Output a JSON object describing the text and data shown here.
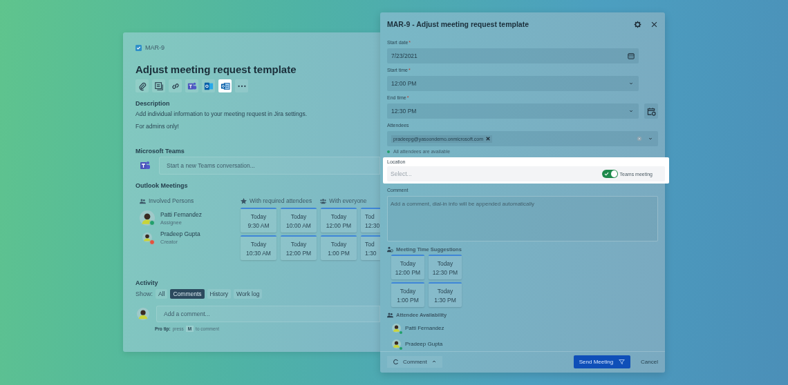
{
  "issue": {
    "key": "MAR-9",
    "title": "Adjust meeting request template",
    "toolbar": [
      {
        "kind": "attach",
        "selected": false
      },
      {
        "kind": "checklist",
        "selected": false
      },
      {
        "kind": "link",
        "selected": false
      },
      {
        "kind": "teams",
        "selected": false
      },
      {
        "kind": "outlook",
        "selected": false
      },
      {
        "kind": "outlook-form",
        "selected": true
      },
      {
        "kind": "more",
        "selected": false
      }
    ],
    "description": {
      "label": "Description",
      "paragraphs": [
        "Add individual information to your meeting request in Jira settings.",
        "For admins only!"
      ]
    },
    "teams": {
      "label": "Microsoft Teams",
      "placeholder": "Start a new Teams conversation..."
    },
    "outlook": {
      "label": "Outlook Meetings",
      "persons_label": "Involved Persons",
      "required_label": "With required attendees",
      "everyone_label": "With everyone",
      "persons": [
        {
          "name": "Patti Fernandez",
          "role": "Assignee",
          "color": "#22a06b"
        },
        {
          "name": "Pradeep Gupta",
          "role": "Creator",
          "color": "#e5533d"
        }
      ],
      "slots": [
        {
          "kind": "full",
          "day": "Today",
          "time": "9:30 AM"
        },
        {
          "kind": "full",
          "day": "Today",
          "time": "10:00 AM"
        },
        {
          "kind": "full",
          "day": "Today",
          "time": "12:00 PM"
        },
        {
          "kind": "cut",
          "day": "Tod",
          "time": "12:30"
        },
        {
          "kind": "full",
          "day": "Today",
          "time": "10:30 AM"
        },
        {
          "kind": "full",
          "day": "Today",
          "time": "12:00 PM"
        },
        {
          "kind": "full",
          "day": "Today",
          "time": "1:00 PM"
        },
        {
          "kind": "cut",
          "day": "Tod",
          "time": "1:30"
        }
      ]
    },
    "activity": {
      "label": "Activity",
      "show_label": "Show:",
      "filters": [
        {
          "label": "All",
          "selected": false
        },
        {
          "label": "Comments",
          "selected": true
        },
        {
          "label": "History",
          "selected": false
        },
        {
          "label": "Work log",
          "selected": false
        }
      ],
      "placeholder": "Add a comment...",
      "tip_label": "Pro tip:",
      "tip_before": "press",
      "tip_key": "M",
      "tip_after": "to comment"
    }
  },
  "dialog": {
    "title": "MAR-9 - Adjust meeting request template",
    "start_date": {
      "label": "Start date",
      "mark": "*",
      "value": "7/23/2021"
    },
    "start_time": {
      "label": "Start time",
      "mark": "*",
      "value": "12:00 PM"
    },
    "end_time": {
      "label": "End time",
      "mark": "*",
      "value": "12:30 PM"
    },
    "attendees": {
      "label": "Attendees",
      "chips": [
        "pradeepg@yasoondemo.onmicrosoft.com"
      ],
      "status": {
        "text": "All attendees are available",
        "color": "#22a06b"
      }
    },
    "location": {
      "label": "Location",
      "placeholder": "Select...",
      "toggle_label": "Teams meeting",
      "on": true
    },
    "comment": {
      "label": "Comment",
      "placeholder": "Add a comment, dial-in info will be appended automatically"
    },
    "suggestions_label": "Meeting Time Suggestions",
    "suggestions": [
      {
        "day": "Today",
        "time": "12:00 PM"
      },
      {
        "day": "Today",
        "time": "12:30 PM"
      },
      {
        "day": "Today",
        "time": "1:00 PM"
      },
      {
        "day": "Today",
        "time": "1:30 PM"
      }
    ],
    "availability_label": "Attendee Availability",
    "availability": [
      {
        "name": "Patti Fernandez",
        "color": "#22a06b"
      },
      {
        "name": "Pradeep Gupta",
        "color": "#22a06b"
      }
    ],
    "footer": {
      "comment_button": "Comment",
      "send_button": "Send Meeting",
      "cancel_button": "Cancel"
    }
  }
}
